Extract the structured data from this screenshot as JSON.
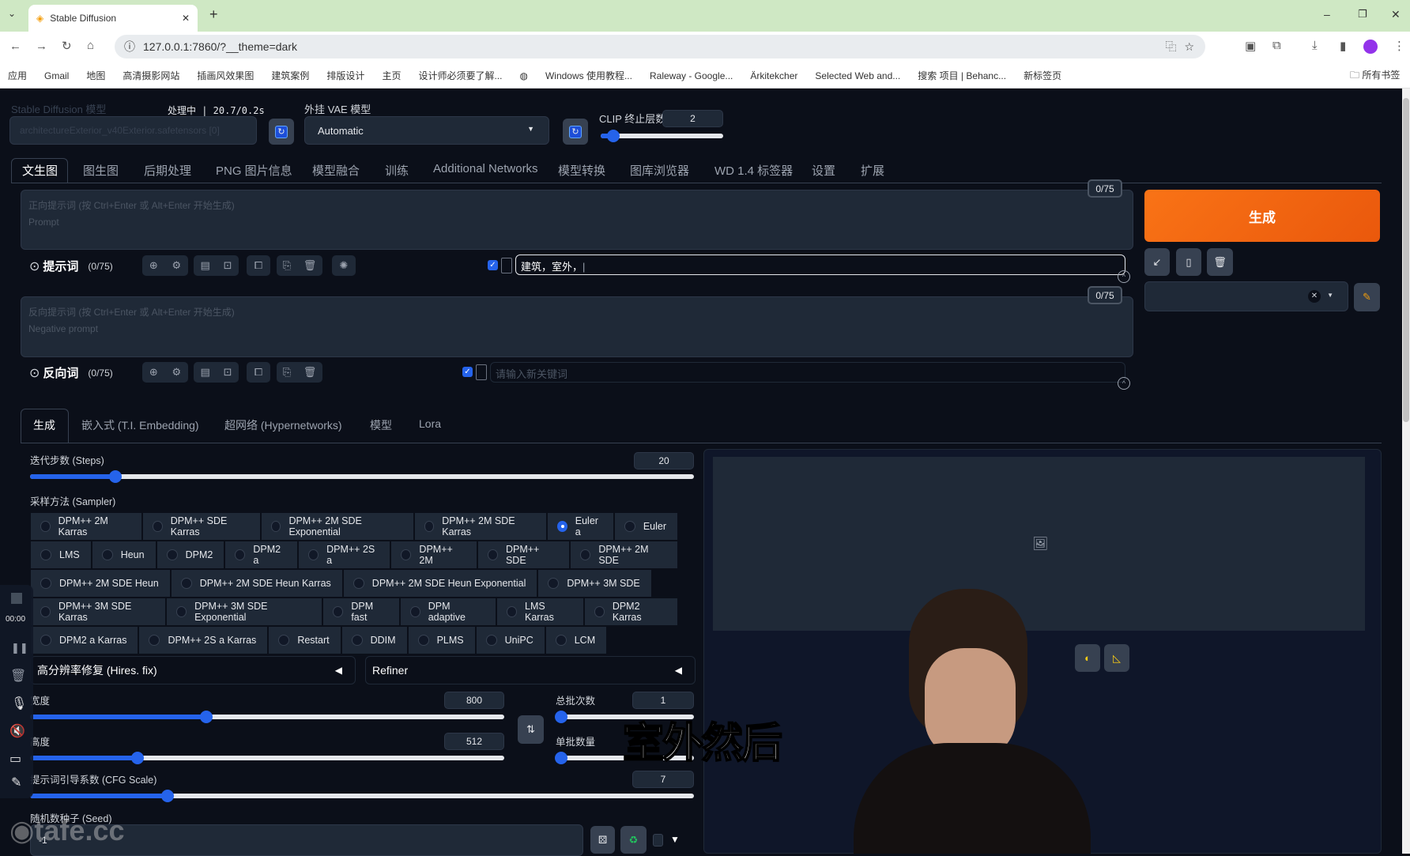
{
  "browser": {
    "tab_title": "Stable Diffusion",
    "url": "127.0.0.1:7860/?__theme=dark",
    "bookmarks": [
      "应用",
      "Gmail",
      "地图",
      "高清摄影网站",
      "插画风效果图",
      "建筑案例",
      "排版设计",
      "主页",
      "设计师必须要了解...",
      "",
      "Windows 使用教程...",
      "Raleway - Google...",
      "Ärkitekcher",
      "Selected Web and...",
      "搜索 项目 | Behanc...",
      "新标签页"
    ],
    "all_bookmarks": "所有书签"
  },
  "header": {
    "model_label": "Stable Diffusion 模型",
    "model_value": "architectureExterior_v40Exterior.safetensors [0]",
    "status": "处理中 | 20.7/0.2s",
    "vae_label": "外挂 VAE 模型",
    "vae_value": "Automatic",
    "clip_label": "CLIP 终止层数",
    "clip_value": "2",
    "clip_fraction": 0.1
  },
  "tabs": [
    "文生图",
    "图生图",
    "后期处理",
    "PNG 图片信息",
    "模型融合",
    "训练",
    "Additional Networks",
    "模型转换",
    "图库浏览器",
    "WD 1.4 标签器",
    "设置",
    "扩展"
  ],
  "prompt": {
    "placeholder1": "正向提示词 (按 Ctrl+Enter 或 Alt+Enter 开始生成)",
    "placeholder2": "Prompt",
    "count": "0/75",
    "title": "提示词",
    "title_count": "(0/75)",
    "tag_input": "建筑，室外，"
  },
  "negative": {
    "placeholder1": "反向提示词 (按 Ctrl+Enter 或 Alt+Enter 开始生成)",
    "placeholder2": "Negative prompt",
    "count": "0/75",
    "title": "反向词",
    "title_count": "(0/75)",
    "tag_placeholder": "请输入新关键词"
  },
  "generate": {
    "label": "生成"
  },
  "subtabs": [
    "生成",
    "嵌入式 (T.I. Embedding)",
    "超网络 (Hypernetworks)",
    "模型",
    "Lora"
  ],
  "steps": {
    "label": "迭代步数 (Steps)",
    "value": "20",
    "fraction": 0.128
  },
  "sampler": {
    "label": "采样方法 (Sampler)",
    "selected": "Euler a",
    "options": [
      "DPM++ 2M Karras",
      "DPM++ SDE Karras",
      "DPM++ 2M SDE Exponential",
      "DPM++ 2M SDE Karras",
      "Euler a",
      "Euler",
      "LMS",
      "Heun",
      "DPM2",
      "DPM2 a",
      "DPM++ 2S a",
      "DPM++ 2M",
      "DPM++ SDE",
      "DPM++ 2M SDE",
      "DPM++ 2M SDE Heun",
      "DPM++ 2M SDE Heun Karras",
      "DPM++ 2M SDE Heun Exponential",
      "DPM++ 3M SDE",
      "DPM++ 3M SDE Karras",
      "DPM++ 3M SDE Exponential",
      "DPM fast",
      "DPM adaptive",
      "LMS Karras",
      "DPM2 Karras",
      "DPM2 a Karras",
      "DPM++ 2S a Karras",
      "Restart",
      "DDIM",
      "PLMS",
      "UniPC",
      "LCM"
    ]
  },
  "hires": {
    "label": "高分辨率修复 (Hires. fix)"
  },
  "refiner": {
    "label": "Refiner"
  },
  "width": {
    "label": "宽度",
    "value": "800",
    "fraction": 0.371
  },
  "height": {
    "label": "高度",
    "value": "512",
    "fraction": 0.226
  },
  "batch_count": {
    "label": "总批次数",
    "value": "1",
    "fraction": 0
  },
  "batch_size": {
    "label": "单批数量",
    "value": "",
    "fraction": 0
  },
  "cfg": {
    "label": "提示词引导系数 (CFG Scale)",
    "value": "7",
    "fraction": 0.207
  },
  "seed": {
    "label": "随机数种子 (Seed)",
    "value": "-1"
  },
  "overlay": {
    "subtitle": "室外然后",
    "timer": "00:00",
    "watermark": "tafe.cc"
  },
  "colors": {
    "accent": "#2563eb",
    "generate": "#f97316",
    "bg": "#0b0f19",
    "panel": "#1f2937"
  }
}
